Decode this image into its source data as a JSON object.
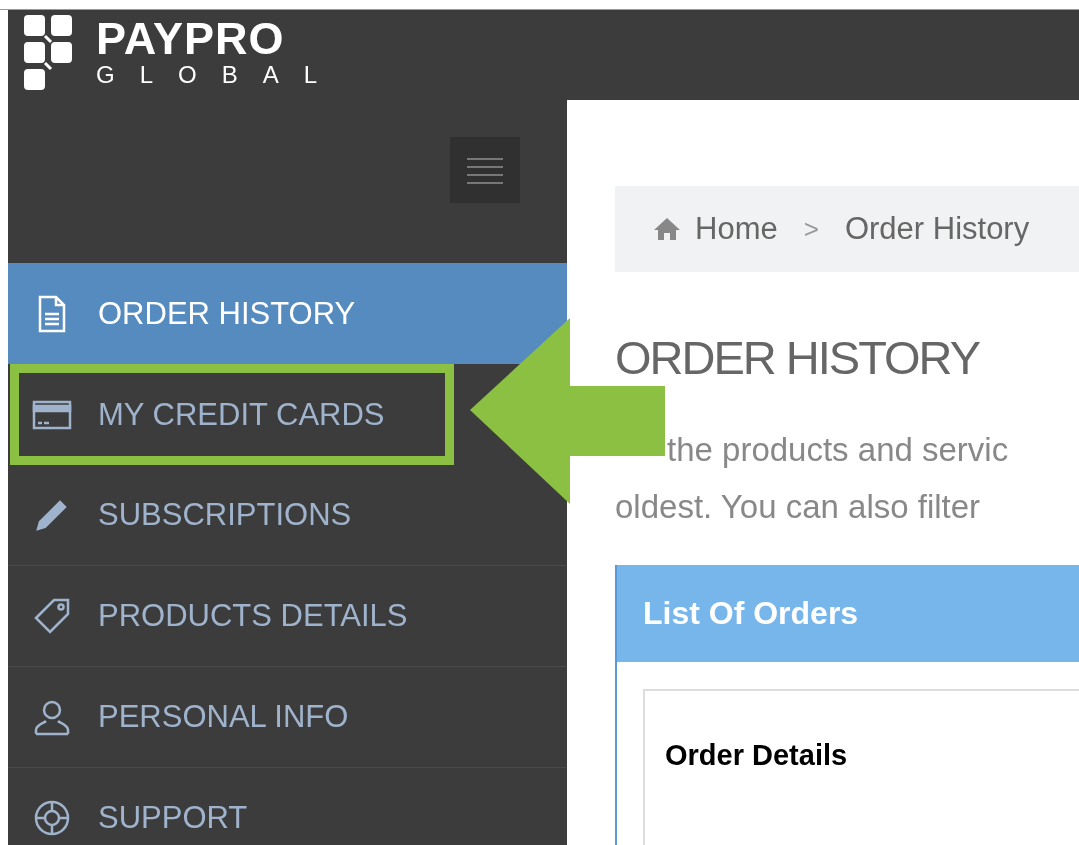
{
  "logo": {
    "line_1": "PAYPRO",
    "line_2": "GLOBAL"
  },
  "sidebar": {
    "items": [
      {
        "label": "ORDER HISTORY",
        "selected": true,
        "annotated": false
      },
      {
        "label": "MY CREDIT CARDS",
        "selected": false,
        "annotated": true
      },
      {
        "label": "SUBSCRIPTIONS",
        "selected": false,
        "annotated": false
      },
      {
        "label": "PRODUCTS DETAILS",
        "selected": false,
        "annotated": false
      },
      {
        "label": "PERSONAL INFO",
        "selected": false,
        "annotated": false
      },
      {
        "label": "SUPPORT",
        "selected": false,
        "annotated": false
      }
    ]
  },
  "breadcrumb": {
    "separator": ">",
    "items": [
      "Home",
      "Order History"
    ]
  },
  "page_title": "ORDER HISTORY",
  "description_lines": [
    "the products and servic",
    "oldest. You can also filter"
  ],
  "panel": {
    "title": "List Of Orders",
    "section_title": "Order Details"
  }
}
